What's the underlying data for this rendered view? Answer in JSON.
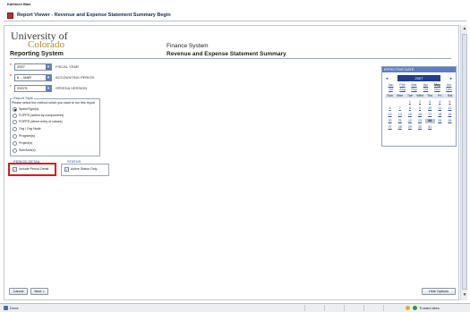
{
  "user": {
    "name": "Kathleen Blas"
  },
  "window": {
    "title": "Report Viewer - Revenue and Expense Statement Summary Begin"
  },
  "header": {
    "logo_line1": "University of",
    "logo_line2": "Colorado",
    "reporting": "Reporting System",
    "system": "Finance System",
    "report": "Revenue and Expense Statement Summary"
  },
  "params": [
    {
      "value": "2007",
      "label": "FISCAL YEAR"
    },
    {
      "value": "6 -- MAR",
      "label": "ACCOUNTING PERIOD"
    },
    {
      "value": "2007S",
      "label": "SPEEDA VERSION"
    }
  ],
  "report_style": {
    "title": "Report Style",
    "instruction": "Please select the method which you want to run this report",
    "options": [
      "SpeedType(s)",
      "FOPPS (select by components)",
      "FOPPS (direct entry of values)",
      "Org / Org Node",
      "Program(s)",
      "Project(s)",
      "Sub/Acct(s)"
    ],
    "selected_index": 0
  },
  "period_detail": {
    "title": "PERIOD DETAIL",
    "checkbox": "Include Period Detail",
    "checked": true
  },
  "status": {
    "title": "STATUS",
    "checkbox": "Active Status Only",
    "checked": true
  },
  "calendar": {
    "title": "EFFECTIVE DATE",
    "prev": "◄",
    "next": "►",
    "year": "2007",
    "months": [
      "Jan",
      "Feb",
      "Mar",
      "Apr",
      "May",
      "Jun",
      "Jul",
      "Aug",
      "Sep",
      "Oct",
      "Nov",
      "Dec"
    ],
    "current_month": "May",
    "dows": [
      "Sun",
      "Mon",
      "Tue",
      "Wed",
      "Thu",
      "Fri",
      "Sat"
    ],
    "days": [
      "",
      "",
      "1",
      "2",
      "3",
      "4",
      "5",
      "6",
      "7",
      "8",
      "9",
      "10",
      "11",
      "12",
      "13",
      "14",
      "15",
      "16",
      "17",
      "18",
      "19",
      "20",
      "21",
      "22",
      "23",
      "24",
      "25",
      "26",
      "27",
      "28",
      "29",
      "30",
      "31",
      "",
      ""
    ],
    "selected_day": "24"
  },
  "buttons": {
    "cancel": "Cancel",
    "next": "Next >",
    "hide": "Hide Options"
  },
  "statusbar": {
    "left": "Done",
    "zone": "Trusted sites"
  },
  "colors": {
    "accent": "#203f8a",
    "gold": "#b08a2a",
    "highlight": "#e01818"
  }
}
